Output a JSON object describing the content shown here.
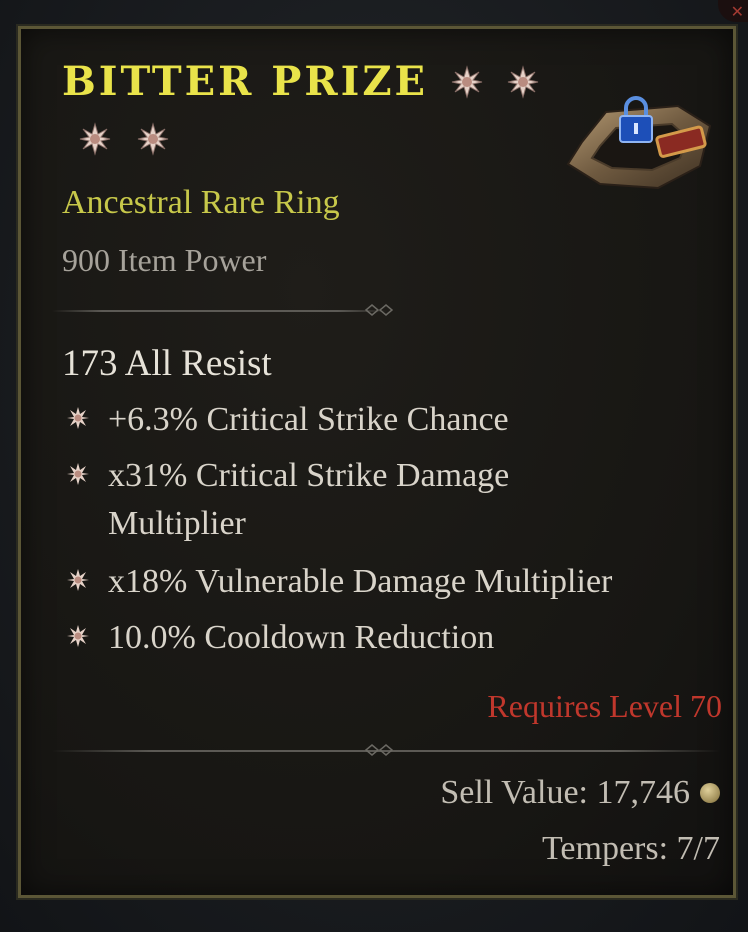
{
  "item": {
    "name": "BITTER PRIZE",
    "type": "Ancestral Rare Ring",
    "item_power": "900 Item Power",
    "base_stat": "173 All Resist",
    "affixes": [
      "+6.3% Critical Strike Chance",
      "x31% Critical Strike Damage Multiplier",
      "x18% Vulnerable Damage Multiplier",
      "10.0% Cooldown Reduction"
    ],
    "requirement": "Requires Level 70",
    "sell_value": "Sell Value: 17,746",
    "tempers": "Tempers: 7/7",
    "greater_affix_stars": 4,
    "icons": {
      "star": "greater-affix-star-icon",
      "affix_bullet": "affix-bullet-icon",
      "lock": "lock-icon",
      "coin": "gold-coin-icon",
      "close": "close-icon"
    }
  },
  "colors": {
    "title": "#e9e34a",
    "rarity": "#c7c84a",
    "requirement": "#c0372c",
    "text": "#d9d4ca",
    "muted": "#a6a29a"
  }
}
